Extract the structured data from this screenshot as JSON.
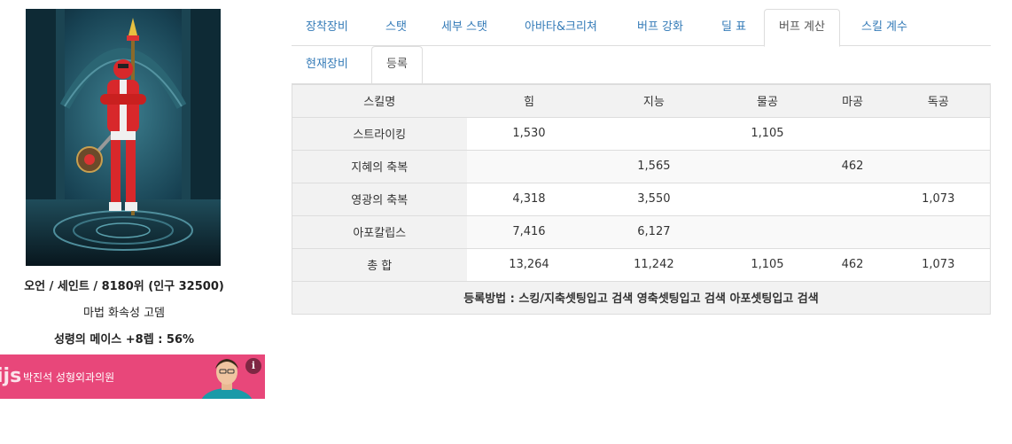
{
  "character": {
    "info_line": "오언 / 세인트 / 8180위 (인구 32500)",
    "title_line": "마법 화속성 고뎀",
    "weapon_prefix": "성령의 메이스 +8렙 : ",
    "weapon_pct": "56%"
  },
  "ad": {
    "logo": "ijs",
    "text": "박진석 성형외과의원",
    "info_glyph": "i"
  },
  "tabs_main": [
    {
      "label": "장착장비",
      "active": false
    },
    {
      "label": "스탯",
      "active": false
    },
    {
      "label": "세부 스탯",
      "active": false
    },
    {
      "label": "아바타&크리쳐",
      "active": false
    },
    {
      "label": "버프 강화",
      "active": false
    },
    {
      "label": "딜 표",
      "active": false
    },
    {
      "label": "버프 계산",
      "active": true
    },
    {
      "label": "스킬 계수",
      "active": false
    }
  ],
  "tabs_sub": [
    {
      "label": "현재장비",
      "active": false
    },
    {
      "label": "등록",
      "active": true
    }
  ],
  "table": {
    "headers": [
      "스킬명",
      "힘",
      "지능",
      "물공",
      "마공",
      "독공"
    ],
    "rows": [
      {
        "name": "스트라이킹",
        "values": [
          "1,530",
          "",
          "1,105",
          "",
          ""
        ]
      },
      {
        "name": "지혜의 축복",
        "values": [
          "",
          "1,565",
          "",
          "462",
          ""
        ]
      },
      {
        "name": "영광의 축복",
        "values": [
          "4,318",
          "3,550",
          "",
          "",
          "1,073"
        ]
      },
      {
        "name": "아포칼립스",
        "values": [
          "7,416",
          "6,127",
          "",
          "",
          ""
        ]
      },
      {
        "name": "총 합",
        "values": [
          "13,264",
          "11,242",
          "1,105",
          "462",
          "1,073"
        ]
      }
    ],
    "footer": "등록방법 : 스킹/지축셋팅입고 검색 영축셋팅입고 검색 아포셋팅입고 검색"
  },
  "colors": {
    "ad_bg": "#e8477a",
    "tab_link": "#337ab7",
    "header_bg": "#f2f2f2"
  }
}
